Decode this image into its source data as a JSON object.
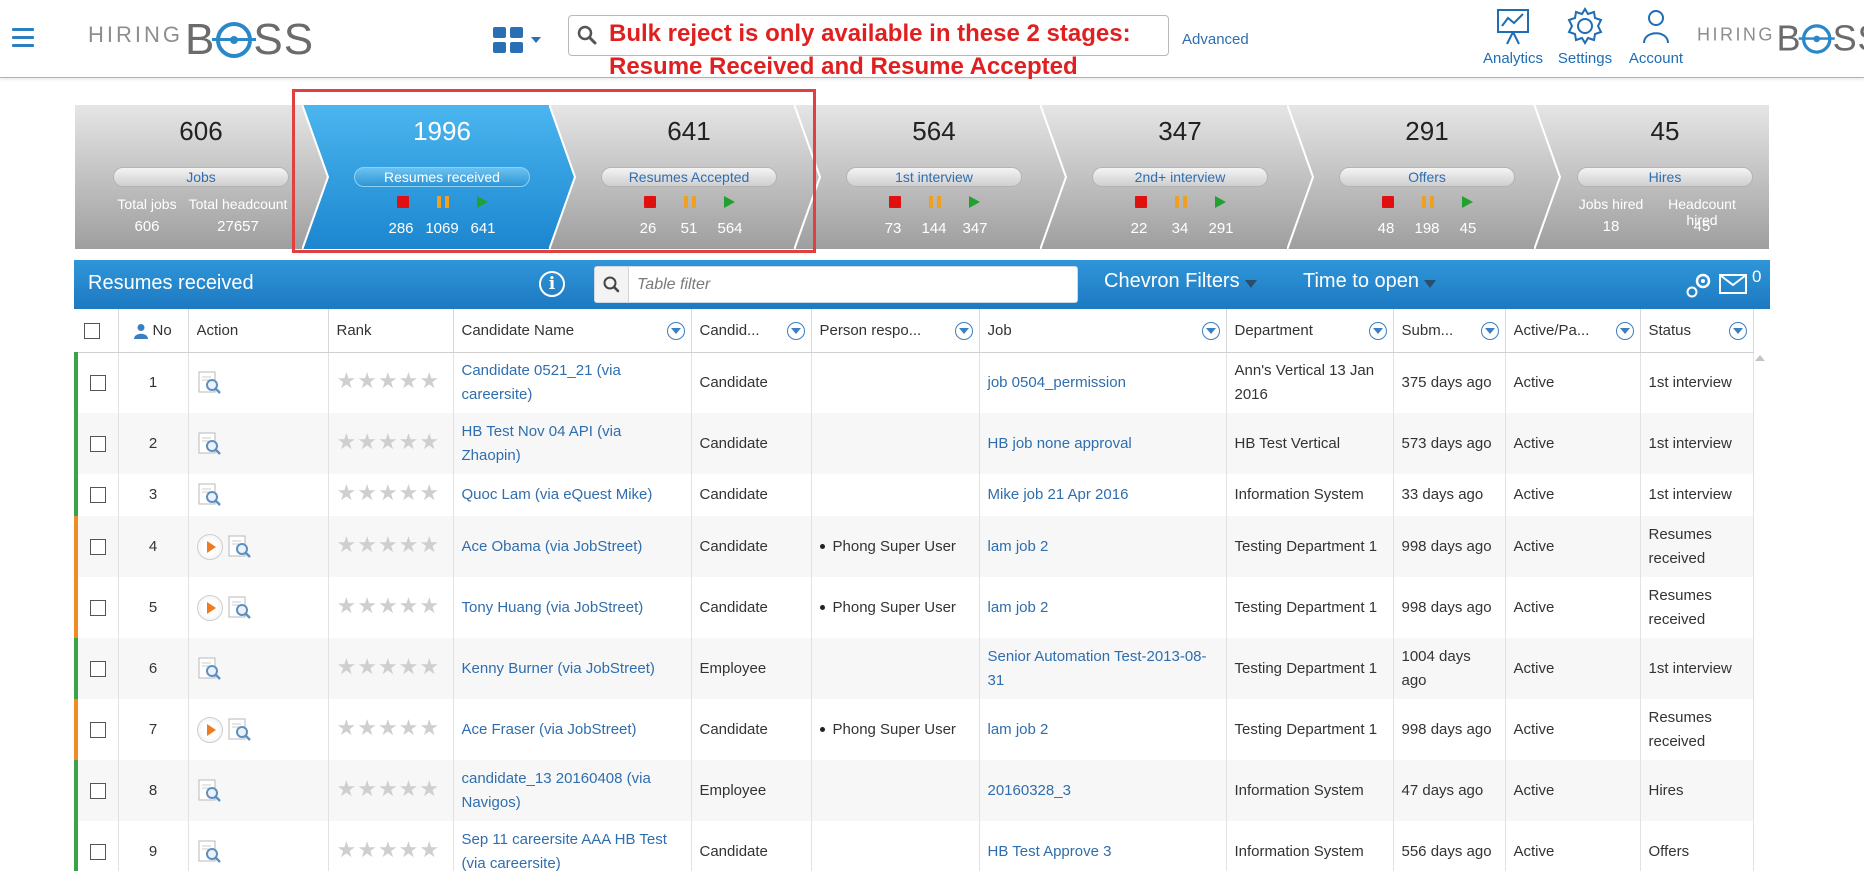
{
  "header": {
    "logo_hiring": "HIRING",
    "logo_boss_b": "B",
    "logo_boss_ss": "SS",
    "advanced": "Advanced",
    "analytics": "Analytics",
    "settings": "Settings",
    "account": "Account",
    "annotation_line1": "Bulk reject is only available in these 2 stages:",
    "annotation_line2": "Resume Received and Resume Accepted"
  },
  "pipeline": [
    {
      "count": "606",
      "label": "Jobs",
      "type": "summary",
      "sub_labels": [
        "Total jobs",
        "Total headcount"
      ],
      "sub_values": [
        "606",
        "27657"
      ]
    },
    {
      "count": "1996",
      "label": "Resumes received",
      "type": "stage",
      "values": [
        "286",
        "1069",
        "641"
      ],
      "active": true
    },
    {
      "count": "641",
      "label": "Resumes Accepted",
      "type": "stage",
      "values": [
        "26",
        "51",
        "564"
      ]
    },
    {
      "count": "564",
      "label": "1st interview",
      "type": "stage",
      "values": [
        "73",
        "144",
        "347"
      ]
    },
    {
      "count": "347",
      "label": "2nd+ interview",
      "type": "stage",
      "values": [
        "22",
        "34",
        "291"
      ]
    },
    {
      "count": "291",
      "label": "Offers",
      "type": "stage",
      "values": [
        "48",
        "198",
        "45"
      ]
    },
    {
      "count": "45",
      "label": "Hires",
      "type": "summary",
      "sub_labels": [
        "Jobs hired",
        "Headcount hired"
      ],
      "sub_values": [
        "18",
        "45"
      ]
    }
  ],
  "panel": {
    "title": "Resumes received",
    "info": "i",
    "filter_placeholder": "Table filter",
    "chevron_filters": "Chevron Filters",
    "time_to_open": "Time to open",
    "mail_count": "0"
  },
  "table": {
    "columns": [
      "No",
      "Action",
      "Rank",
      "Candidate Name",
      "Candid...",
      "Person respo...",
      "Job",
      "Department",
      "Subm...",
      "Active/Pa...",
      "Status"
    ],
    "rows": [
      {
        "no": "1",
        "name": "Candidate 0521_21 (via careersite)",
        "type": "Candidate",
        "person": "",
        "job": "job 0504_permission",
        "dept": "Ann's Vertical 13 Jan 2016",
        "submitted": "375 days ago",
        "active": "Active",
        "status": "1st interview",
        "play": false,
        "accent": "green"
      },
      {
        "no": "2",
        "name": "HB Test Nov 04 API (via Zhaopin)",
        "type": "Candidate",
        "person": "",
        "job": "HB job none approval",
        "dept": "HB Test Vertical",
        "submitted": "573 days ago",
        "active": "Active",
        "status": "1st interview",
        "play": false,
        "accent": "green"
      },
      {
        "no": "3",
        "name": "Quoc Lam (via eQuest Mike)",
        "type": "Candidate",
        "person": "",
        "job": "Mike job 21 Apr 2016",
        "dept": "Information System",
        "submitted": "33 days ago",
        "active": "Active",
        "status": "1st interview",
        "play": false,
        "accent": "green"
      },
      {
        "no": "4",
        "name": "Ace Obama (via JobStreet)",
        "type": "Candidate",
        "person": "Phong Super User",
        "job": "lam job 2",
        "dept": "Testing Department 1",
        "submitted": "998 days ago",
        "active": "Active",
        "status": "Resumes received",
        "play": true,
        "accent": "orange"
      },
      {
        "no": "5",
        "name": "Tony Huang (via JobStreet)",
        "type": "Candidate",
        "person": "Phong Super User",
        "job": "lam job 2",
        "dept": "Testing Department 1",
        "submitted": "998 days ago",
        "active": "Active",
        "status": "Resumes received",
        "play": true,
        "accent": "orange"
      },
      {
        "no": "6",
        "name": "Kenny Burner (via JobStreet)",
        "type": "Employee",
        "person": "",
        "job": "Senior Automation Test-2013-08-31",
        "dept": "Testing Department 1",
        "submitted": "1004 days ago",
        "active": "Active",
        "status": "1st interview",
        "play": false,
        "accent": "green"
      },
      {
        "no": "7",
        "name": "Ace Fraser (via JobStreet)",
        "type": "Candidate",
        "person": "Phong Super User",
        "job": "lam job 2",
        "dept": "Testing Department 1",
        "submitted": "998 days ago",
        "active": "Active",
        "status": "Resumes received",
        "play": true,
        "accent": "orange"
      },
      {
        "no": "8",
        "name": "candidate_13 20160408 (via Navigos)",
        "type": "Employee",
        "person": "",
        "job": "20160328_3",
        "dept": "Information System",
        "submitted": "47 days ago",
        "active": "Active",
        "status": "Hires",
        "play": false,
        "accent": "green"
      },
      {
        "no": "9",
        "name": "Sep 11 careersite AAA HB Test (via careersite)",
        "type": "Candidate",
        "person": "",
        "job": "HB Test Approve 3",
        "dept": "Information System",
        "submitted": "556 days ago",
        "active": "Active",
        "status": "Offers",
        "play": false,
        "accent": "green"
      }
    ]
  },
  "colors": {
    "accent": "#1d79c2",
    "active_chevron": "#2a9ae0",
    "stop": "#e01010",
    "pause": "#f0a020",
    "play": "#22a030"
  },
  "icons": [
    "menu-icon",
    "apps-grid-icon",
    "search-icon",
    "analytics-icon",
    "settings-icon",
    "account-icon",
    "info-icon",
    "filter-icon",
    "gear-icon",
    "mail-icon",
    "magnifier-icon",
    "play-icon",
    "star-icon"
  ]
}
